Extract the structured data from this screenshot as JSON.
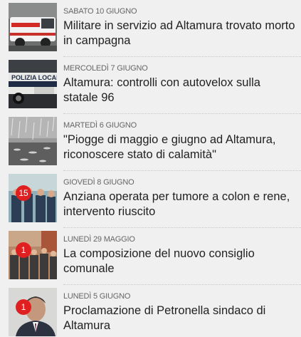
{
  "news": {
    "items": [
      {
        "date": "SABATO 10 GIUGNO",
        "title": "Militare in servizio ad Altamura trovato morto in campagna",
        "thumbnail": "ambulance-photo",
        "badge": ""
      },
      {
        "date": "MERCOLEDÌ 7 GIUGNO",
        "title": "Altamura: controlli con autovelox sulla statale 96",
        "thumbnail": "police-car-photo",
        "badge": ""
      },
      {
        "date": "MARTEDÌ 6 GIUGNO",
        "title": "\"Piogge di maggio e giugno ad Altamura, riconoscere stato di calamità\"",
        "thumbnail": "rain-photo",
        "badge": ""
      },
      {
        "date": "GIOVEDÌ 8 GIUGNO",
        "title": "Anziana operata per tumore a colon e rene, intervento riuscito",
        "thumbnail": "surgeons-photo",
        "badge": "15"
      },
      {
        "date": "LUNEDÌ 29 MAGGIO",
        "title": "La composizione del nuovo consiglio comunale",
        "thumbnail": "crowd-photo",
        "badge": "1"
      },
      {
        "date": "LUNEDÌ 5 GIUGNO",
        "title": "Proclamazione di Petronella sindaco di Altamura",
        "thumbnail": "portrait-photo",
        "badge": "1"
      }
    ]
  },
  "colors": {
    "background": "#f0f0f0",
    "badge": "#e02020",
    "title": "#222222",
    "date": "#666666"
  }
}
